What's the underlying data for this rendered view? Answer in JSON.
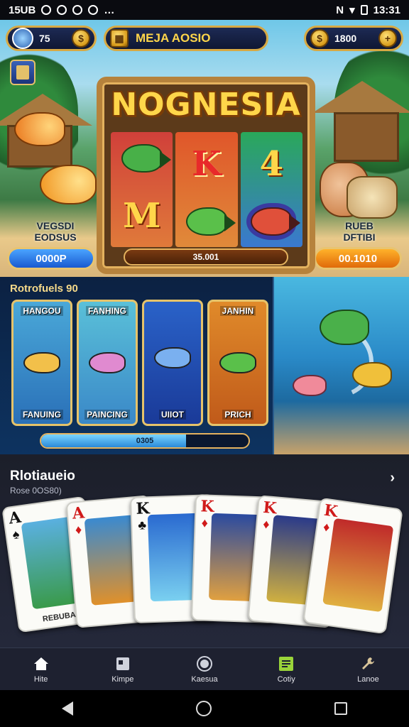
{
  "status_bar": {
    "time_left": "15UB",
    "time_right": "13:31"
  },
  "top_bar": {
    "balance": "75",
    "title": "MEJA AOSIO",
    "coins": "1800"
  },
  "slot": {
    "title": "NOGNESIA",
    "symbols": [
      "K",
      "4",
      "M"
    ],
    "bar_text": "35.001"
  },
  "left_panel": {
    "label_line1": "VEGSDI",
    "label_line2": "EODSUS",
    "button": "0000P"
  },
  "right_panel": {
    "label_line1": "RUEB",
    "label_line2": "DFTIBI",
    "button": "00.1010"
  },
  "fishing": {
    "title": "Rotrofuels 90",
    "cards": [
      {
        "top": "HANGOU",
        "bottom": "FANUING"
      },
      {
        "top": "FANHING",
        "bottom": "PAINCING"
      },
      {
        "top": "",
        "bottom": "UIIOT"
      },
      {
        "top": "JANHIN",
        "bottom": "PRICH"
      }
    ],
    "progress": 0.7,
    "progress_label": "0305"
  },
  "cards_section": {
    "title": "Rlotiaueio",
    "subtitle": "Rose 0OS80)",
    "cards": [
      {
        "rank": "A",
        "suit": "♠",
        "footer": "REBUBA"
      },
      {
        "rank": "A",
        "suit": "♦",
        "footer": ""
      },
      {
        "rank": "K",
        "suit": "♣",
        "footer": ""
      },
      {
        "rank": "K",
        "suit": "♦",
        "footer": ""
      },
      {
        "rank": "K",
        "suit": "♦",
        "footer": ""
      },
      {
        "rank": "K",
        "suit": "♦",
        "footer": ""
      }
    ]
  },
  "bottom_nav": [
    {
      "label": "Hite",
      "icon": "home-icon"
    },
    {
      "label": "Kimpe",
      "icon": "book-icon"
    },
    {
      "label": "Kaesua",
      "icon": "circle-icon"
    },
    {
      "label": "Cotiy",
      "icon": "list-icon"
    },
    {
      "label": "Lanoe",
      "icon": "wrench-icon"
    }
  ],
  "colors": {
    "gold": "#e4b25e",
    "accent_blue": "#2a8ad8",
    "accent_orange": "#e06a0a"
  }
}
